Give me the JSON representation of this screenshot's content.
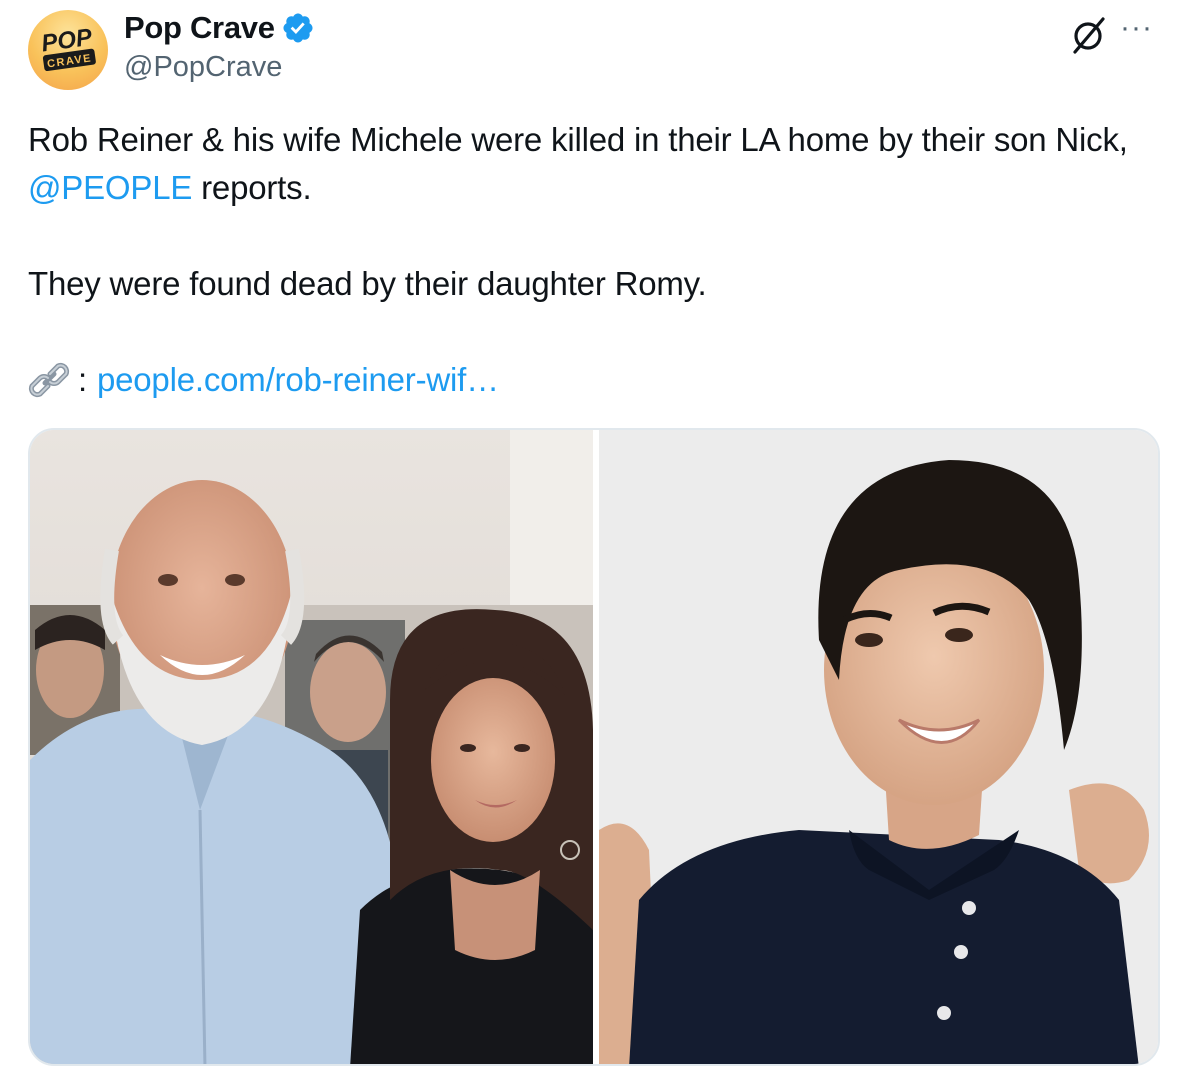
{
  "account": {
    "display_name": "Pop Crave",
    "handle": "@PopCrave",
    "verified": true,
    "avatar_logo_top": "POP",
    "avatar_logo_bottom": "CRAVE"
  },
  "header_icons": [
    "grok-icon",
    "more-options-icon"
  ],
  "tweet": {
    "text_line1_prefix": "Rob Reiner & his wife Michele were killed in their LA home by their son Nick, ",
    "mention": "@PEOPLE",
    "text_line1_suffix": " reports.",
    "text_line2": "They were found dead by their daughter Romy.",
    "link_prefix": ":",
    "link_text": "people.com/rob-reiner-wif…",
    "link_icon": "link-emoji-icon"
  },
  "media": {
    "count": 2,
    "images": [
      "photo-couple",
      "photo-young-man"
    ]
  },
  "colors": {
    "link_blue": "#1d9bf0",
    "verified_blue": "#1d9bf0",
    "secondary_text": "#536471",
    "primary_text": "#0f1419"
  }
}
